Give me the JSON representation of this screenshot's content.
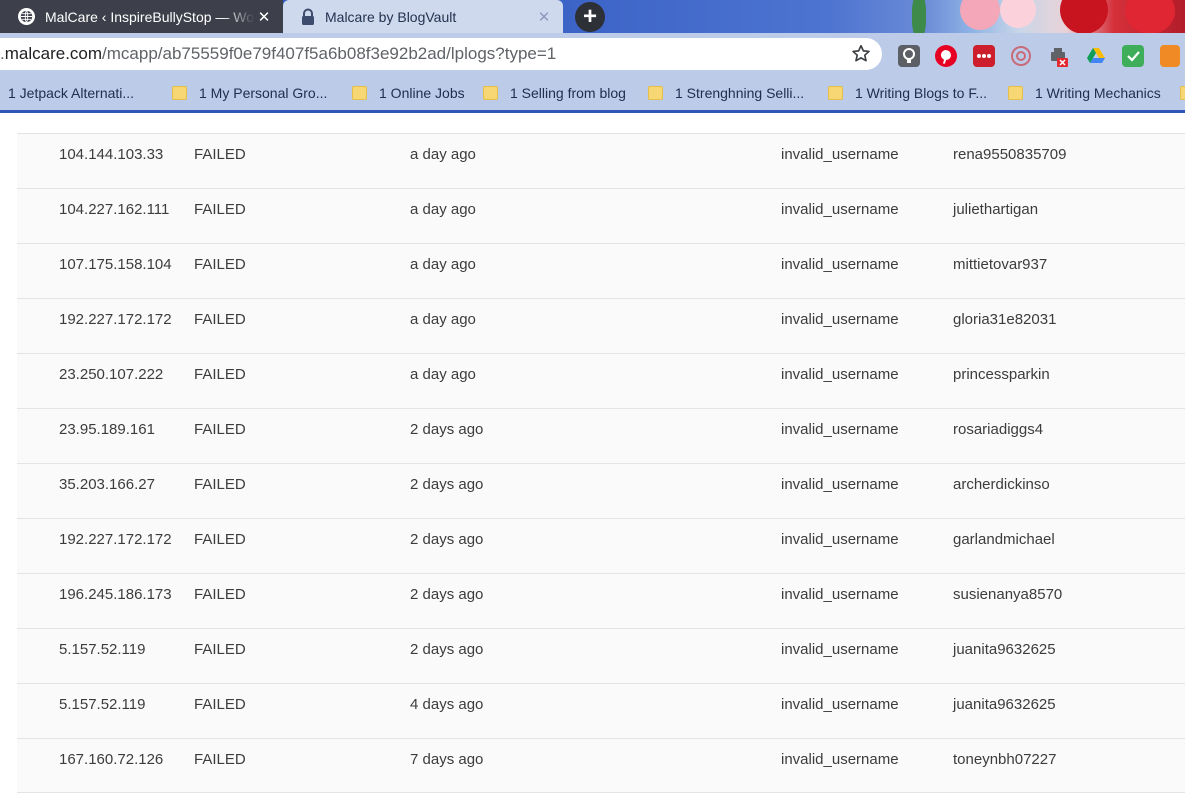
{
  "browser": {
    "tabs": [
      {
        "title": "MalCare ‹ InspireBullyStop — Wo",
        "icon": "globe-icon",
        "active": false
      },
      {
        "title": "Malcare by BlogVault",
        "icon": "lock-icon",
        "active": true
      }
    ],
    "close_glyph": "✕",
    "new_tab_glyph": "+",
    "address": {
      "domain": "malcare.com",
      "path": "/mcapp/ab75559f0e79f407f5a6b08f3e92b2ad/lplogs?type=1",
      "prefix": "."
    },
    "bookmarks": [
      "1 Jetpack  Alternati...",
      "1 My Personal Gro...",
      "1 Online Jobs",
      "1 Selling from blog",
      "1 Strenghning Selli...",
      "1 Writing Blogs to F...",
      "1 Writing Mechanics"
    ]
  },
  "logs": {
    "rows": [
      {
        "ip": "104.144.103.33",
        "status": "FAILED",
        "time": "a day ago",
        "reason": "invalid_username",
        "username": "rena9550835709"
      },
      {
        "ip": "104.227.162.111",
        "status": "FAILED",
        "time": "a day ago",
        "reason": "invalid_username",
        "username": "juliethartigan"
      },
      {
        "ip": "107.175.158.104",
        "status": "FAILED",
        "time": "a day ago",
        "reason": "invalid_username",
        "username": "mittietovar937"
      },
      {
        "ip": "192.227.172.172",
        "status": "FAILED",
        "time": "a day ago",
        "reason": "invalid_username",
        "username": "gloria31e82031"
      },
      {
        "ip": "23.250.107.222",
        "status": "FAILED",
        "time": "a day ago",
        "reason": "invalid_username",
        "username": "princessparkin"
      },
      {
        "ip": "23.95.189.161",
        "status": "FAILED",
        "time": "2 days ago",
        "reason": "invalid_username",
        "username": "rosariadiggs4"
      },
      {
        "ip": "35.203.166.27",
        "status": "FAILED",
        "time": "2 days ago",
        "reason": "invalid_username",
        "username": "archerdickinso"
      },
      {
        "ip": "192.227.172.172",
        "status": "FAILED",
        "time": "2 days ago",
        "reason": "invalid_username",
        "username": "garlandmichael"
      },
      {
        "ip": "196.245.186.173",
        "status": "FAILED",
        "time": "2 days ago",
        "reason": "invalid_username",
        "username": "susienanya8570"
      },
      {
        "ip": "5.157.52.119",
        "status": "FAILED",
        "time": "2 days ago",
        "reason": "invalid_username",
        "username": "juanita9632625"
      },
      {
        "ip": "5.157.52.119",
        "status": "FAILED",
        "time": "4 days ago",
        "reason": "invalid_username",
        "username": "juanita9632625"
      },
      {
        "ip": "167.160.72.126",
        "status": "FAILED",
        "time": "7 days ago",
        "reason": "invalid_username",
        "username": "toneynbh07227"
      }
    ]
  }
}
